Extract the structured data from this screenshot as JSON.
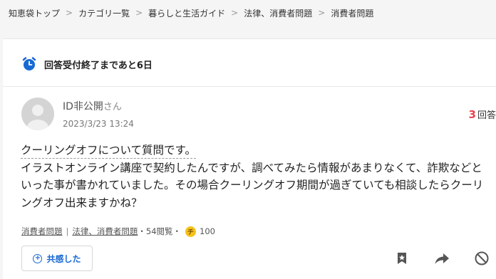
{
  "breadcrumb": {
    "items": [
      "知恵袋トップ",
      "カテゴリ一覧",
      "暮らしと生活ガイド",
      "法律、消費者問題",
      "消費者問題"
    ],
    "separator": ">"
  },
  "deadline": {
    "text": "回答受付終了まであと6日"
  },
  "question": {
    "user": "ID非公開",
    "user_suffix": "さん",
    "date": "2023/3/23 13:24",
    "answers_count": "3",
    "answers_label": "回答",
    "line1": "クーリングオフについて質問です。",
    "body": "イラストオンライン講座で契約したんですが、調べてみたら情報があまりなくて、詐欺などといった事が書かれていました。その場合クーリングオフ期間が過ぎていても相談したらクーリングオフ出来ますかね？"
  },
  "meta": {
    "category1": "消費者問題",
    "divider": "|",
    "category2": "法律、消費者問題",
    "views": "・54閲覧・",
    "coin_label": "チ",
    "coins": "100"
  },
  "actions": {
    "empathy_label": "共感した",
    "bookmark_icon": "bookmark-icon",
    "share_icon": "share-icon",
    "block_icon": "block-icon"
  },
  "colors": {
    "accent": "#1869d3",
    "answer_count": "#e8414f",
    "coin": "#f5c21b"
  }
}
